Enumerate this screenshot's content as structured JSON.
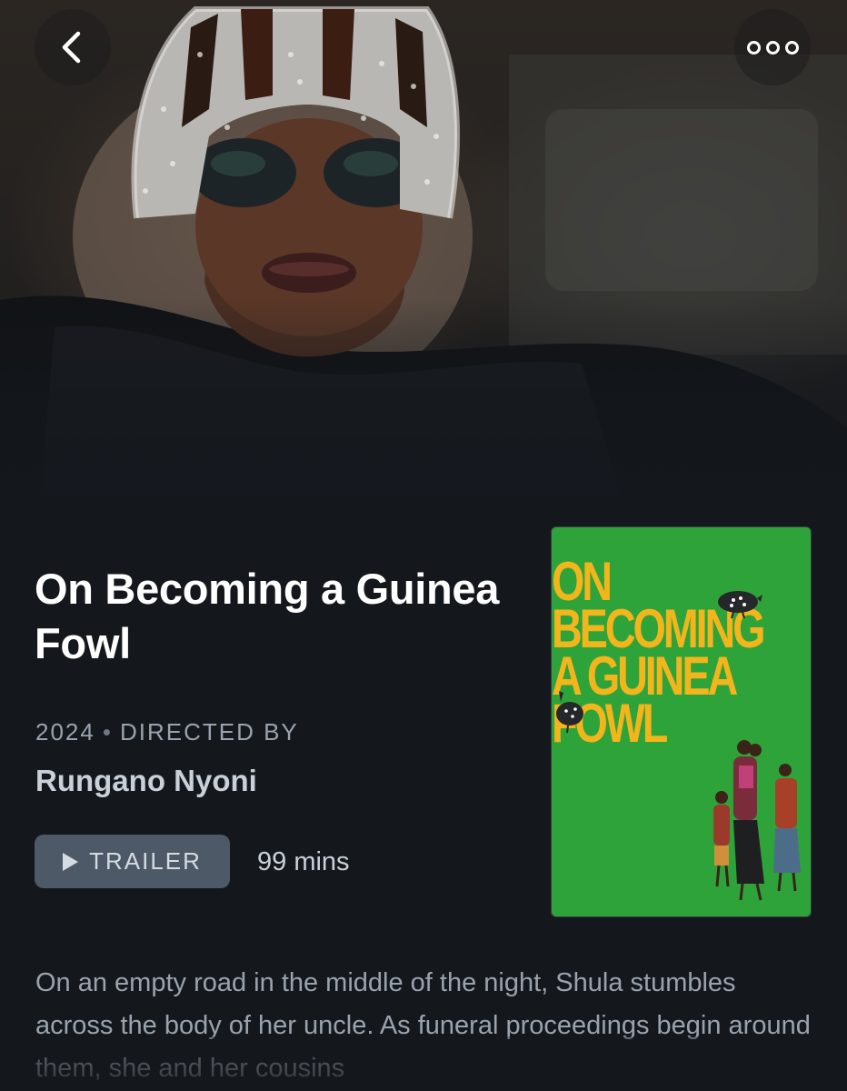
{
  "nav": {
    "back_icon": "chevron-left-icon",
    "more_icon": "more-horizontal-icon"
  },
  "film": {
    "title": "On Becoming a Guinea Fowl",
    "year": "2024",
    "separator": "•",
    "directed_by_label": "DIRECTED BY",
    "director": "Rungano Nyoni",
    "trailer_label": "TRAILER",
    "runtime": "99 mins",
    "synopsis": "On an empty road in the middle of the night, Shula stumbles across the body of her uncle. As funeral proceedings begin around them, she and her cousins"
  },
  "poster": {
    "title_lines": [
      "ON",
      "BECOMING",
      "A GUINEA",
      "FOWL"
    ],
    "background_color": "#2ea33a",
    "title_color": "#f2b51c"
  },
  "colors": {
    "page_background": "#14181d",
    "button_background": "#4d5966",
    "muted_text": "#9aa3ad"
  }
}
